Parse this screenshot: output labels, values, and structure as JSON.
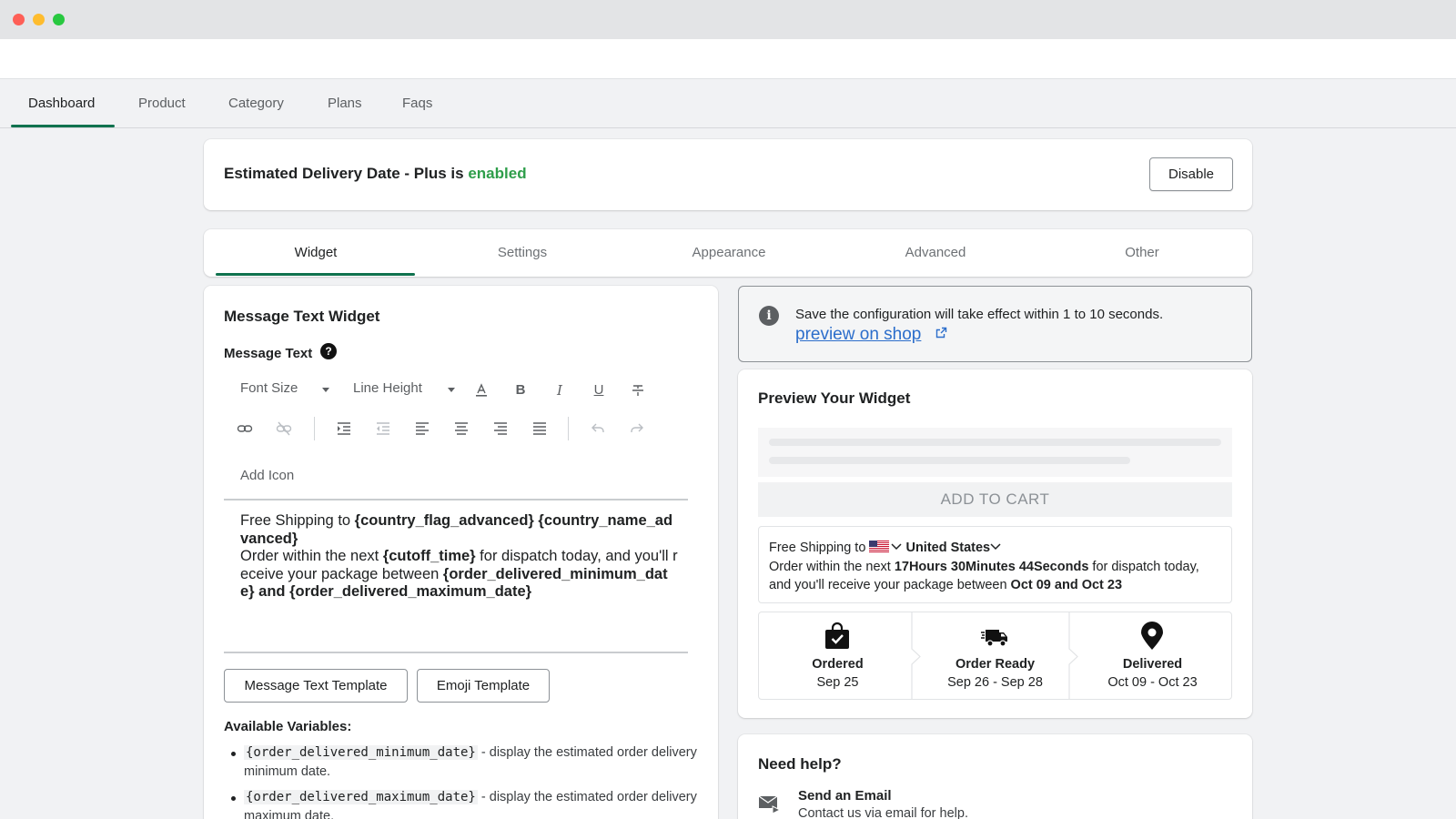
{
  "main_nav": {
    "items": [
      {
        "label": "Dashboard",
        "active": true
      },
      {
        "label": "Product",
        "active": false
      },
      {
        "label": "Category",
        "active": false
      },
      {
        "label": "Plans",
        "active": false
      },
      {
        "label": "Faqs",
        "active": false
      }
    ]
  },
  "status": {
    "prefix": "Estimated Delivery Date - Plus is",
    "state": "enabled",
    "state_color": "#2e9e4a",
    "button_label": "Disable"
  },
  "sub_tabs": {
    "items": [
      {
        "label": "Widget",
        "active": true
      },
      {
        "label": "Settings",
        "active": false
      },
      {
        "label": "Appearance",
        "active": false
      },
      {
        "label": "Advanced",
        "active": false
      },
      {
        "label": "Other",
        "active": false
      }
    ],
    "accent_color": "#10724e"
  },
  "editor": {
    "title": "Message Text Widget",
    "message_label": "Message Text",
    "help_icon": "question-circle-icon",
    "font_size_label": "Font Size",
    "line_height_label": "Line Height",
    "add_icon_label": "Add Icon",
    "content": {
      "t1": "Free Shipping to ",
      "v1": "{country_flag_advanced} {country_name_advanced}",
      "t2": "Order within the next ",
      "v2": "{cutoff_time}",
      "t3": " for dispatch today, and you'll receive your package between ",
      "v3": "{order_delivered_minimum_date} and {order_delivered_maximum_date}"
    },
    "template_buttons": [
      "Message Text Template",
      "Emoji Template"
    ],
    "available_label": "Available Variables:",
    "variables": [
      {
        "code": "{order_delivered_minimum_date}",
        "desc": " - display the estimated order delivery minimum date."
      },
      {
        "code": "{order_delivered_maximum_date}",
        "desc": " - display the estimated order delivery maximum date."
      }
    ]
  },
  "info": {
    "text": "Save the configuration will take effect within 1 to 10 seconds.",
    "link": "preview on shop",
    "link_color": "#2c6ecb"
  },
  "preview": {
    "title": "Preview Your Widget",
    "add_to_cart": "ADD TO CART",
    "shipping": {
      "t1": "Free Shipping to",
      "country": "United States",
      "t2": "Order within the next ",
      "cutoff": "17Hours 30Minutes 44Seconds",
      "t3": " for dispatch today, and you'll receive your package between ",
      "range": "Oct 09 and Oct 23"
    },
    "steps": [
      {
        "label": "Ordered",
        "date": "Sep 25",
        "icon": "shopping-bag-check-icon"
      },
      {
        "label": "Order Ready",
        "date": "Sep 26 - Sep 28",
        "icon": "delivery-truck-icon"
      },
      {
        "label": "Delivered",
        "date": "Oct 09 - Oct 23",
        "icon": "map-pin-icon"
      }
    ]
  },
  "help": {
    "title": "Need help?",
    "email_title": "Send an Email",
    "email_sub": "Contact us via email for help."
  }
}
